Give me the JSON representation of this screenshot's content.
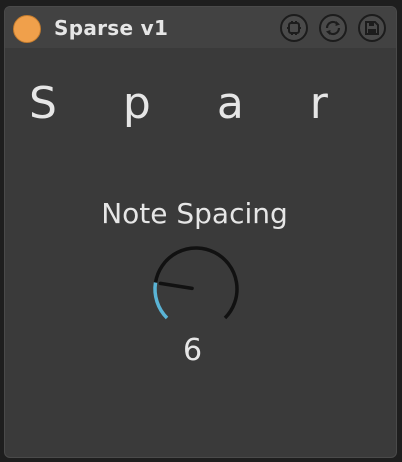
{
  "header": {
    "title": "Sparse v1",
    "power_color": "#f0a04b",
    "buttons": [
      "device-icon",
      "refresh-icon",
      "save-icon"
    ]
  },
  "main": {
    "heading": "S p a r s e",
    "knob": {
      "label": "Note Spacing",
      "value": "6",
      "fraction": 0.2,
      "accent": "#5ab4d6",
      "track": "#111111"
    }
  }
}
